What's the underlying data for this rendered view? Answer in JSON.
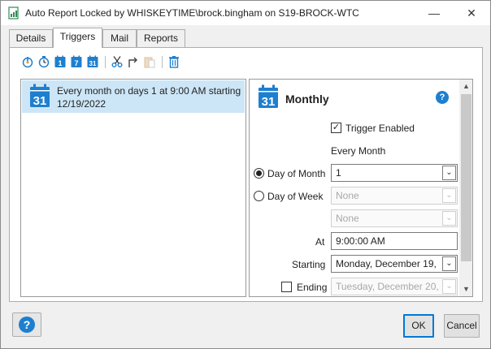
{
  "window": {
    "title": "Auto Report Locked by WHISKEYTIME\\brock.bingham on S19-BROCK-WTC",
    "minimize_icon": "minimize-icon",
    "close_icon": "close-icon"
  },
  "tabs": [
    {
      "label": "Details",
      "active": false
    },
    {
      "label": "Triggers",
      "active": true
    },
    {
      "label": "Mail",
      "active": false
    },
    {
      "label": "Reports",
      "active": false
    }
  ],
  "toolbar": {
    "icons": [
      "new-startup-trigger-icon",
      "new-time-trigger-icon",
      "new-daily-trigger-icon",
      "new-weekly-trigger-icon",
      "new-monthly-trigger-icon",
      "cut-icon",
      "copy-icon",
      "paste-icon",
      "delete-icon"
    ],
    "daily_num": "1",
    "weekly_num": "7",
    "monthly_num": "31"
  },
  "trigger_list": {
    "items": [
      {
        "text": "Every month on days 1 at 9:00 AM starting 12/19/2022",
        "icon": "calendar-31-icon",
        "icon_num": "31",
        "selected": true
      }
    ]
  },
  "detail": {
    "icon_num": "31",
    "heading": "Monthly",
    "trigger_enabled_label": "Trigger Enabled",
    "trigger_enabled_checked": true,
    "every_month_label": "Every Month",
    "day_of_month_label": "Day of Month",
    "day_of_month_value": "1",
    "day_of_week_label": "Day of Week",
    "day_of_week_value1": "None",
    "day_of_week_value2": "None",
    "at_label": "At",
    "at_value": "9:00:00 AM",
    "starting_label": "Starting",
    "starting_value": "Monday, December 19,",
    "ending_label": "Ending",
    "ending_value": "Tuesday, December 20,",
    "ending_checked": false,
    "selected_mode": "day_of_month"
  },
  "footer": {
    "help_label": "?",
    "ok_label": "OK",
    "cancel_label": "Cancel"
  },
  "colors": {
    "accent": "#1e7fcf",
    "selection": "#cde6f7",
    "default_button_border": "#0078d7"
  }
}
